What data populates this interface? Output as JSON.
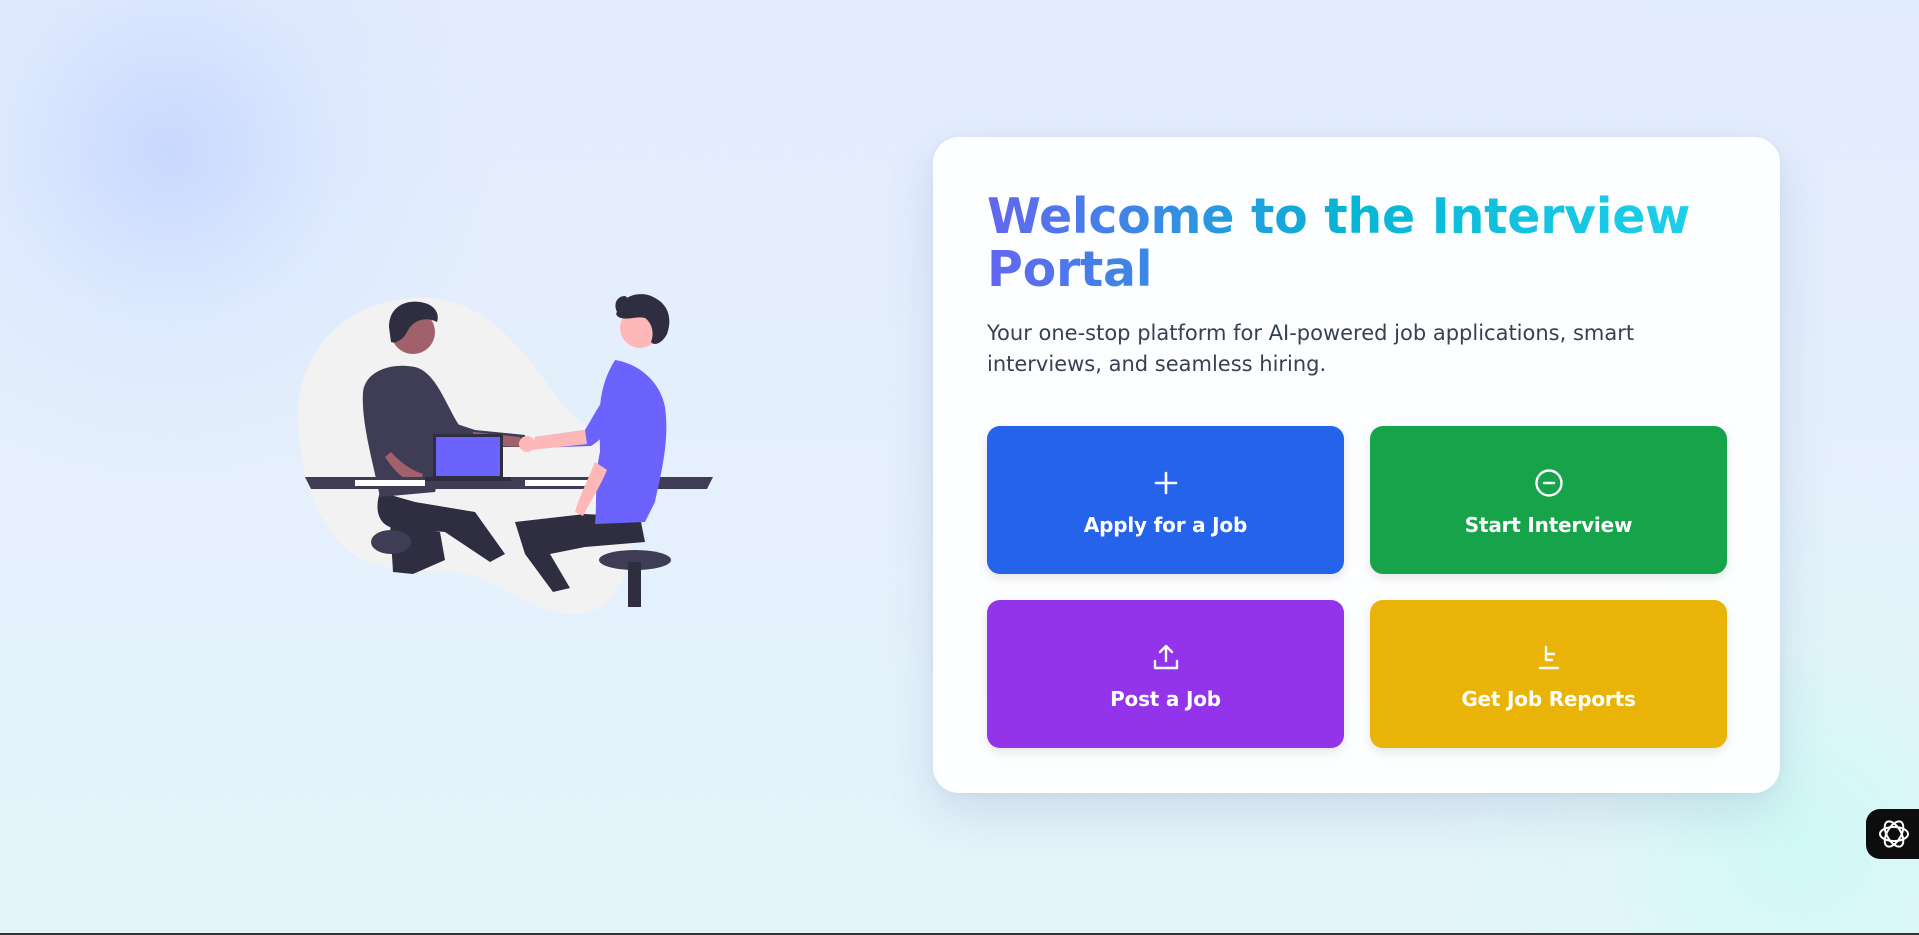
{
  "hero": {
    "title": "Welcome to the Interview Portal",
    "subtitle": "Your one-stop platform for AI-powered job applications, smart interviews, and seamless hiring."
  },
  "actions": [
    {
      "label": "Apply for a Job",
      "icon": "plus-icon",
      "color": "#2563eb"
    },
    {
      "label": "Start Interview",
      "icon": "minus-circle-icon",
      "color": "#16a34a"
    },
    {
      "label": "Post a Job",
      "icon": "upload-icon",
      "color": "#9333ea"
    },
    {
      "label": "Get Job Reports",
      "icon": "report-icon",
      "color": "#eab308"
    }
  ],
  "illustration": {
    "icon": "handshake-illustration",
    "accent": "#6c63ff"
  },
  "widget": {
    "icon": "assistant-logo-icon"
  },
  "colors": {
    "title_gradient_start": "#6366f1",
    "title_gradient_end": "#22d3ee",
    "subtitle": "#374151"
  }
}
